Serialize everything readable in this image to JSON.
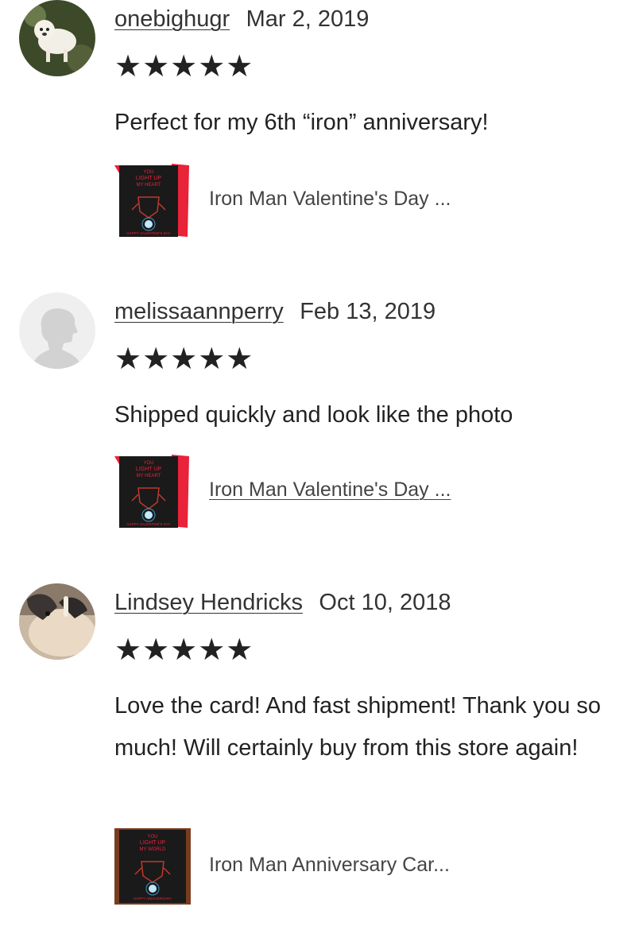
{
  "reviews": [
    {
      "username": "onebighugr",
      "date": "Mar 2, 2019",
      "rating": 5,
      "stars": "★★★★★",
      "text": "Perfect for my 6th “iron” anniversary!",
      "product": {
        "title": "Iron Man Valentine's Day ...",
        "card_lines": [
          "YOU",
          "LIGHT UP",
          "MY HEART",
          "HAPPY VALENTINE'S DAY"
        ]
      }
    },
    {
      "username": "melissaannperry",
      "date": "Feb 13, 2019",
      "rating": 5,
      "stars": "★★★★★",
      "text": "Shipped quickly and look like the photo",
      "product": {
        "title": "Iron Man Valentine's Day ...",
        "card_lines": [
          "YOU",
          "LIGHT UP",
          "MY HEART",
          "HAPPY VALENTINE'S DAY"
        ]
      }
    },
    {
      "username": "Lindsey Hendricks",
      "date": "Oct 10, 2018",
      "rating": 5,
      "stars": "★★★★★",
      "text": "Love the card! And fast shipment! Thank you so much! Will certainly buy from this store again!",
      "product": {
        "title": "Iron Man Anniversary Car...",
        "card_lines": [
          "YOU",
          "LIGHT UP",
          "MY WORLD",
          "HAPPY ANNIVERSARY"
        ]
      }
    }
  ],
  "colors": {
    "text": "#222222",
    "card_bg": "#1a1a1a",
    "card_red": "#e8233a",
    "arc_reactor": "#bfe9ff"
  }
}
